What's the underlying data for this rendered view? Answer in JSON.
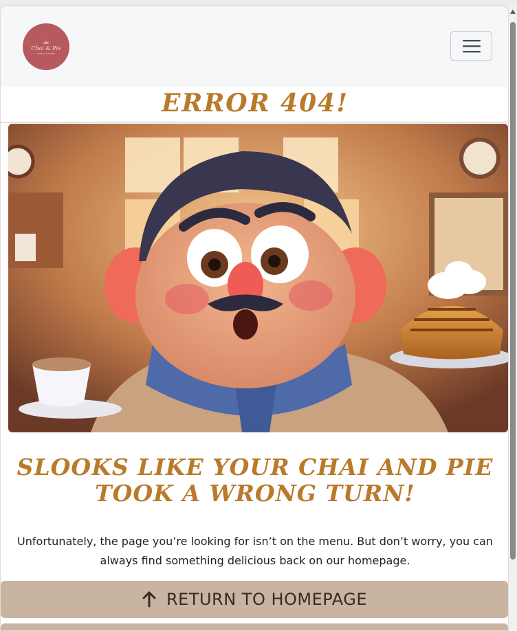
{
  "navbar": {
    "logo": {
      "brand": "Chai & Pie",
      "subtitle": "CAFE & BAKERY",
      "icon": "teacup-icon"
    },
    "menu_toggle_icon": "hamburger-menu-icon"
  },
  "page": {
    "title": "ERROR 404!",
    "heading": "SLOOKS LIKE YOUR CHAI AND PIE TOOK A WRONG TURN!",
    "message": "Unfortunately, the page you’re looking for isn’t on the menu. But don’t worry, you can always find something delicious back on our homepage.",
    "home_button_label": "RETURN TO HOMEPAGE",
    "home_button_icon": "arrow-up-icon"
  },
  "colors": {
    "accent": "#b97a2a",
    "logo_bg": "#b65a60",
    "button_bg": "#c9b4a1",
    "navbar_bg": "#f6f7f9"
  }
}
